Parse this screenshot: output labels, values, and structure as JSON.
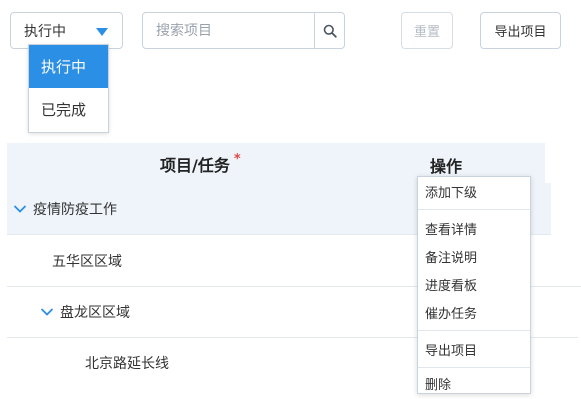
{
  "toolbar": {
    "status_select": {
      "value": "执行中"
    },
    "search": {
      "placeholder": "搜索项目"
    },
    "reset_label": "重置",
    "export_label": "导出项目"
  },
  "status_dropdown": {
    "options": [
      "执行中",
      "已完成"
    ],
    "selected": "执行中"
  },
  "table": {
    "headers": {
      "project": "项目/任务",
      "required_mark": "*",
      "action": "操作"
    },
    "rows": [
      {
        "label": "疫情防疫工作",
        "level": 0,
        "expanded": true
      },
      {
        "label": "五华区区域",
        "level": 1,
        "expanded": false
      },
      {
        "label": "盘龙区区域",
        "level": 1,
        "expanded": true
      },
      {
        "label": "北京路延长线",
        "level": 2,
        "expanded": false
      }
    ]
  },
  "action_menu": {
    "items": [
      "添加下级",
      "查看详情",
      "备注说明",
      "进度看板",
      "催办任务",
      "导出项目",
      "删除"
    ]
  },
  "colors": {
    "accent": "#2b8fe6",
    "required": "#e04848",
    "header_bg": "#eef4fa",
    "border": "#c9d3de"
  },
  "icons": {
    "search": "search-icon",
    "caret": "caret-down-icon",
    "expand": "chevron-down-icon"
  }
}
